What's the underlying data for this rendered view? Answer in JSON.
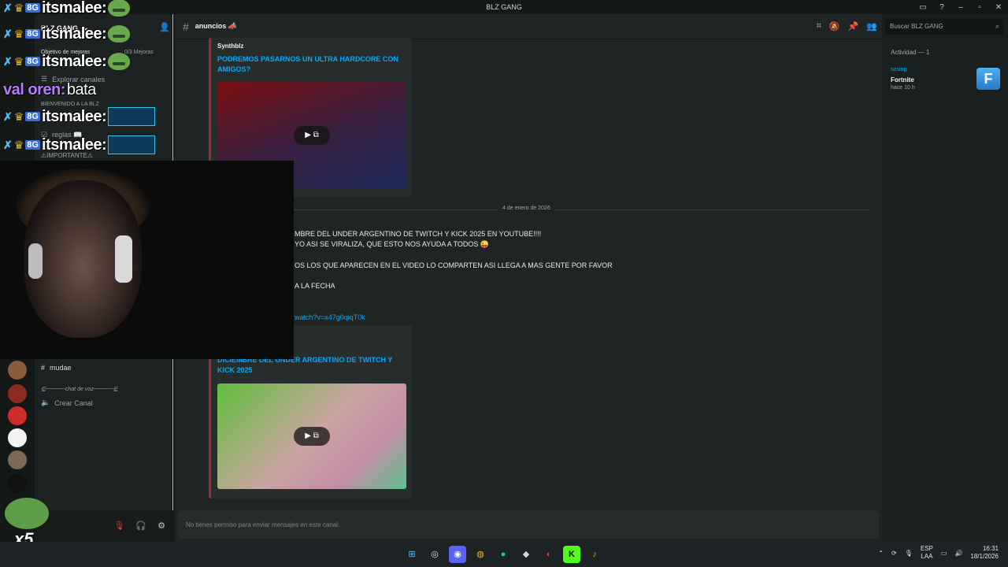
{
  "window": {
    "title": "BLZ GANG"
  },
  "server": {
    "name": "BLZ GANG",
    "boost_label": "Objetivo de mejoras",
    "boost_count": "0/3 Mejoras",
    "explore": "Explorar canales",
    "category_welcome": "BIENVENIDO A LA BLZ",
    "channels": [
      {
        "name": "reglas 📖"
      },
      {
        "name": "⚠IMPORTANTE⚠"
      },
      {
        "name": "mudae"
      }
    ],
    "category_voice": "⋸─────chat de voz─────⋸",
    "create_channel": "Crear Canal"
  },
  "channel": {
    "name": "anuncios 📣"
  },
  "search": {
    "placeholder": "Buscar BLZ GANG"
  },
  "messages": {
    "embed1": {
      "author": "Synthblz",
      "title": "PODREMOS PASARNOS UN ULTRA HARDCORE CON AMIGOS?"
    },
    "date_divider": "4 de enero de 2026",
    "lines": [
      "MBRE DEL UNDER ARGENTINO DE TWITCH Y KICK 2025 EN YOUTUBE!!!!",
      "YO ASI SE VIRALIZA, QUE ESTO NOS AYUDA A TODOS 😜",
      "OS LOS QUE APARECEN EN EL VIDEO LO COMPARTEN ASI LLEGA A MAS GENTE POR FAVOR",
      "A LA FECHA"
    ],
    "link": "watch?v=x47g0qiqT0k",
    "embed2": {
      "title": "DICIEMBRE DEL UNDER ARGENTINO DE TWITCH Y KICK 2025"
    },
    "composer_placeholder": "No tienes permiso para enviar mensajes en este canal."
  },
  "members": {
    "activity_header": "Actividad — 1",
    "user": "sosing",
    "game": "Fortnite",
    "since": "hace 10 h"
  },
  "overlay": {
    "chat_lines": [
      {
        "user": "itsmalee:",
        "badge": "8G"
      },
      {
        "user": "itsmalee:",
        "badge": "8G"
      },
      {
        "user": "itsmalee:",
        "badge": "8G"
      },
      {
        "user": "itsmalee:",
        "badge": "8G"
      },
      {
        "user": "itsmalee:",
        "badge": "8G"
      }
    ],
    "val_user": "val oren:",
    "val_text": "bata",
    "combo": "x5"
  },
  "taskbar": {
    "lang": "ESP",
    "lang2": "LAA",
    "time": "16:31",
    "date": "18/1/2026"
  },
  "colors": {
    "accent_link": "#00a8fc",
    "embed_border": "#a3282d",
    "sidebar_border": "#d4b84a"
  }
}
